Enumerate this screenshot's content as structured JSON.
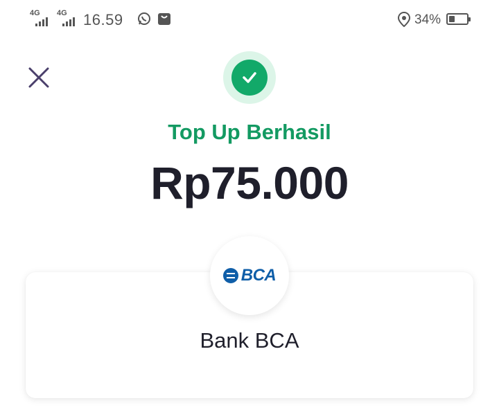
{
  "status_bar": {
    "network_1": "4G",
    "network_2": "4G",
    "time": "16.59",
    "battery_percent": "34%",
    "battery_level": 0.34,
    "icons": [
      "signal-icon",
      "signal-icon",
      "whatsapp-icon",
      "shopping-bag-icon",
      "location-icon",
      "battery-icon"
    ]
  },
  "header": {
    "close_icon": "close-icon"
  },
  "result": {
    "status_icon": "check-circle-icon",
    "title": "Top Up Berhasil",
    "amount": "Rp75.000"
  },
  "bank": {
    "logo_text": "BCA",
    "name": "Bank BCA"
  },
  "colors": {
    "success_green": "#139a62",
    "badge_green": "#12a969",
    "badge_bg": "#dcf5e8",
    "bca_blue": "#0f5ea8",
    "text_dark": "#1f1f2b",
    "status_gray": "#555555"
  }
}
